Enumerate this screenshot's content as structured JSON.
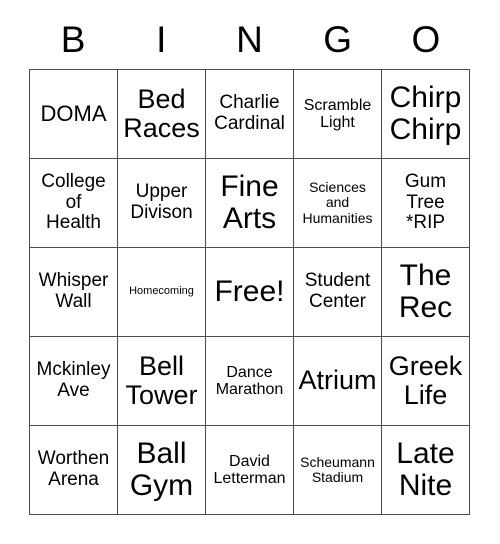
{
  "card": {
    "type": "bingo-card",
    "columns": 5,
    "rows": 5,
    "header_letters": [
      "B",
      "I",
      "N",
      "G",
      "O"
    ],
    "free_space": "Free!",
    "free_space_position": "center",
    "text_color": "#000000",
    "background_color": "#ffffff",
    "border_color": "#4d4d4d",
    "cells": [
      [
        {
          "text": "DOMA",
          "size": "lg"
        },
        {
          "text": "Bed\nRaces",
          "size": "xl"
        },
        {
          "text": "Charlie\nCardinal",
          "size": "md"
        },
        {
          "text": "Scramble\nLight",
          "size": "sm"
        },
        {
          "text": "Chirp\nChirp",
          "size": "xxl"
        }
      ],
      [
        {
          "text": "College\nof\nHealth",
          "size": "md"
        },
        {
          "text": "Upper\nDivison",
          "size": "md"
        },
        {
          "text": "Fine\nArts",
          "size": "xxl"
        },
        {
          "text": "Sciences\nand\nHumanities",
          "size": "xs"
        },
        {
          "text": "Gum\nTree\n*RIP",
          "size": "md"
        }
      ],
      [
        {
          "text": "Whisper\nWall",
          "size": "md"
        },
        {
          "text": "Homecoming",
          "size": "xxs"
        },
        {
          "text": "Free!",
          "size": "xxl"
        },
        {
          "text": "Student\nCenter",
          "size": "md"
        },
        {
          "text": "The\nRec",
          "size": "xxl"
        }
      ],
      [
        {
          "text": "Mckinley\nAve",
          "size": "md"
        },
        {
          "text": "Bell\nTower",
          "size": "xl"
        },
        {
          "text": "Dance\nMarathon",
          "size": "sm"
        },
        {
          "text": "Atrium",
          "size": "xl"
        },
        {
          "text": "Greek\nLife",
          "size": "xl"
        }
      ],
      [
        {
          "text": "Worthen\nArena",
          "size": "md"
        },
        {
          "text": "Ball\nGym",
          "size": "xxl"
        },
        {
          "text": "David\nLetterman",
          "size": "sm"
        },
        {
          "text": "Scheumann\nStadium",
          "size": "xs"
        },
        {
          "text": "Late\nNite",
          "size": "xxl"
        }
      ]
    ]
  }
}
